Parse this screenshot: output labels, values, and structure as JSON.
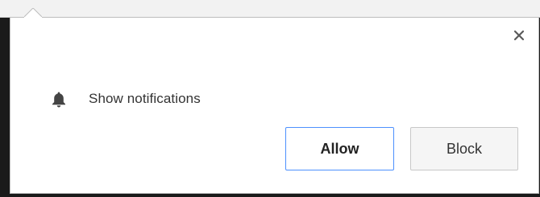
{
  "prompt": {
    "origin_text": "",
    "permission_label": "Show notifications",
    "allow_label": "Allow",
    "block_label": "Block"
  },
  "icons": {
    "close": "close-icon",
    "bell": "bell-icon"
  },
  "colors": {
    "dialog_background": "#ffffff",
    "allow_border": "#4d90fe",
    "block_border": "#c8c8c8",
    "text": "#333333",
    "background": "#1a1a1a"
  }
}
